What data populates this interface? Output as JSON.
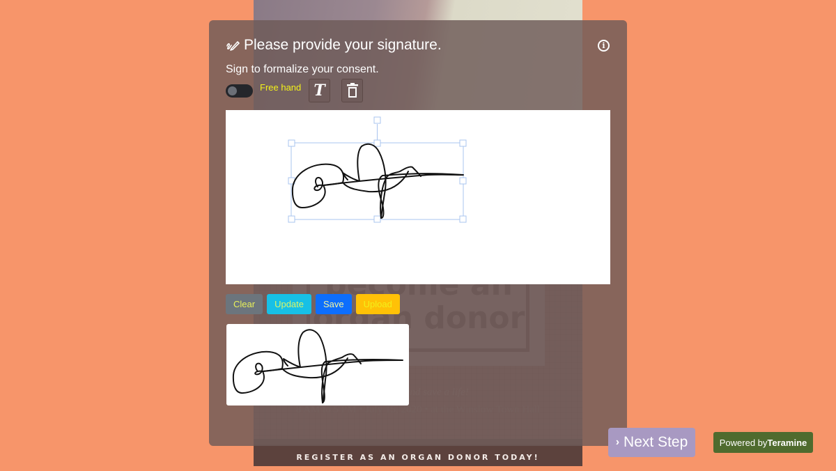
{
  "background_page": {
    "poster_title_line1": "become an",
    "poster_title_line2": "organ donor",
    "tagline": "Register and save a life!",
    "details": "8 AM to 5 PM • July 15, 2020 • at the Winslow Town Hall",
    "register_banner": "REGISTER AS AN ORGAN DONOR TODAY!"
  },
  "modal": {
    "title": "Please provide your signature.",
    "title_icon": "signature-icon",
    "info_icon": "info-icon",
    "subtitle": "Sign to formalize your consent.",
    "mode_toggle": {
      "label": "Free hand",
      "on": false
    },
    "tools": [
      {
        "name": "text-tool",
        "icon": "text-T-icon",
        "glyph": "T"
      },
      {
        "name": "delete-tool",
        "icon": "trash-icon"
      }
    ],
    "buttons": {
      "clear": "Clear",
      "update": "Update",
      "save": "Save",
      "upload": "Upload"
    }
  },
  "footer": {
    "next_step": "Next Step",
    "powered_prefix": "Powered by",
    "powered_brand": "Teramine"
  },
  "colors": {
    "page_background": "#f7956a",
    "toggle_label": "#f3f21a",
    "clear_bg": "#6c757d",
    "update_bg": "#17c0e6",
    "save_bg": "#0d6efd",
    "upload_bg": "#ffc107",
    "next_step_bg": "#a899c2",
    "powered_bg": "#4f6b2e",
    "selection_handles": "#a9c4ef"
  }
}
